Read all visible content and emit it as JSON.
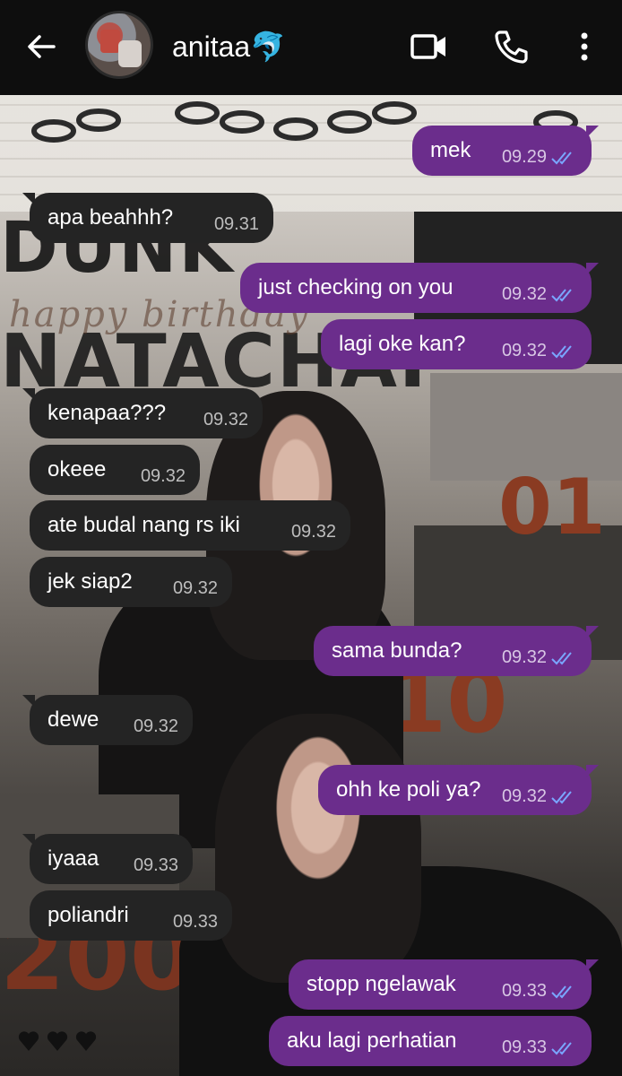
{
  "header": {
    "contact_name": "anitaa🐬"
  },
  "messages": [
    {
      "dir": "out",
      "text": "mek",
      "time": "09.29"
    },
    {
      "dir": "in",
      "text": "apa beahhh?",
      "time": "09.31"
    },
    {
      "dir": "out",
      "text": "just checking on you",
      "time": "09.32"
    },
    {
      "dir": "out",
      "text": "lagi oke kan?",
      "time": "09.32"
    },
    {
      "dir": "in",
      "text": "kenapaa???",
      "time": "09.32"
    },
    {
      "dir": "in",
      "text": "okeee",
      "time": "09.32"
    },
    {
      "dir": "in",
      "text": "ate budal nang rs iki",
      "time": "09.32"
    },
    {
      "dir": "in",
      "text": "jek siap2",
      "time": "09.32"
    },
    {
      "dir": "out",
      "text": "sama bunda?",
      "time": "09.32"
    },
    {
      "dir": "in",
      "text": "dewe",
      "time": "09.32"
    },
    {
      "dir": "out",
      "text": "ohh ke poli ya?",
      "time": "09.32"
    },
    {
      "dir": "in",
      "text": "iyaaa",
      "time": "09.33"
    },
    {
      "dir": "in",
      "text": "poliandri",
      "time": "09.33"
    },
    {
      "dir": "out",
      "text": "stopp ngelawak",
      "time": "09.33"
    },
    {
      "dir": "out",
      "text": "aku lagi perhatian",
      "time": "09.33"
    }
  ],
  "wallpaper": {
    "text_1": "DUNK",
    "text_2": "NATACHAI",
    "text_3": "happy birthday",
    "num_1": "01",
    "num_2": "10",
    "num_3": "2000"
  },
  "colors": {
    "header_bg": "#0e0e0e",
    "incoming_bubble": "#242424",
    "outgoing_bubble": "#6b2d8c",
    "read_ticks": "#7aa7ff"
  },
  "icons": [
    "back-arrow-icon",
    "video-call-icon",
    "phone-icon",
    "more-options-icon",
    "double-check-icon"
  ]
}
